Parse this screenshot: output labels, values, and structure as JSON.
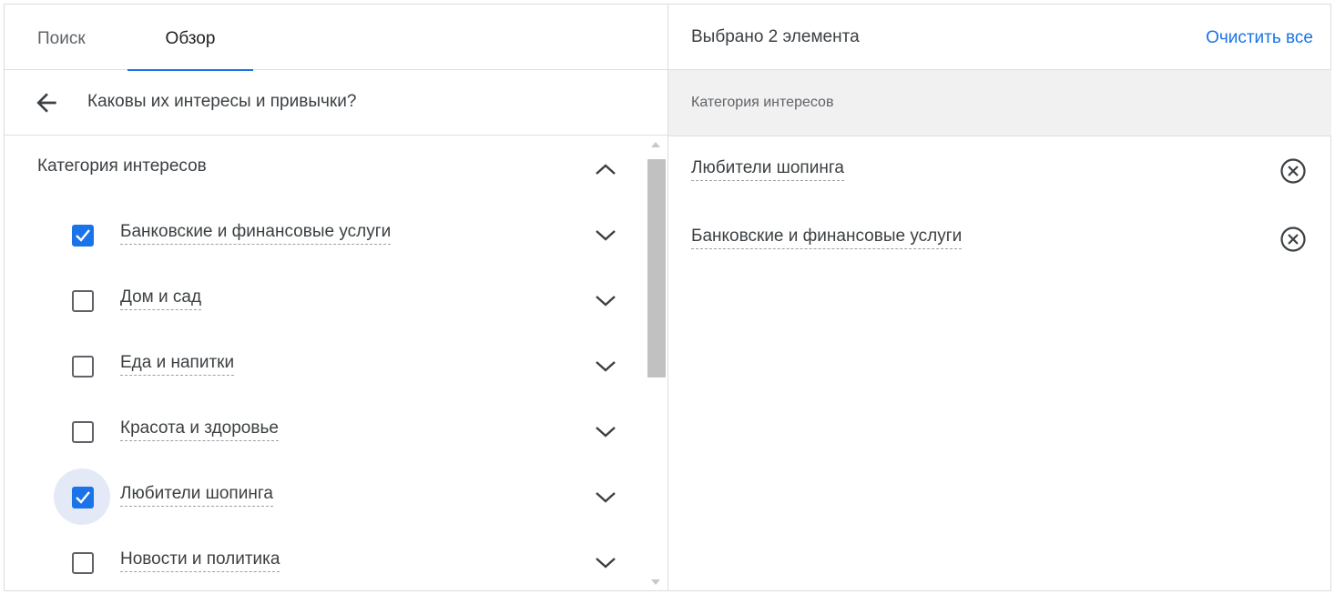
{
  "tabs": [
    {
      "label": "Поиск",
      "active": false
    },
    {
      "label": "Обзор",
      "active": true
    }
  ],
  "colors": {
    "accent": "#1a73e8",
    "text": "#3c4043",
    "muted": "#5f6368",
    "group_bg": "#f1f1f1"
  },
  "browse": {
    "title": "Каковы их интересы и привычки?",
    "back_icon": "arrow-back-icon",
    "category": {
      "label": "Категория интересов",
      "expanded": true,
      "items": [
        {
          "label": "Банковские и финансовые услуги",
          "checked": true
        },
        {
          "label": "Дом и сад",
          "checked": false
        },
        {
          "label": "Еда и напитки",
          "checked": false
        },
        {
          "label": "Красота и здоровье",
          "checked": false
        },
        {
          "label": "Любители шопинга",
          "checked": true,
          "focused": true
        },
        {
          "label": "Новости и политика",
          "checked": false
        }
      ]
    }
  },
  "selection": {
    "count_label": "Выбрано 2 элемента",
    "clear_label": "Очистить все",
    "group_label": "Категория интересов",
    "items": [
      {
        "label": "Любители шопинга"
      },
      {
        "label": "Банковские и финансовые услуги"
      }
    ]
  }
}
